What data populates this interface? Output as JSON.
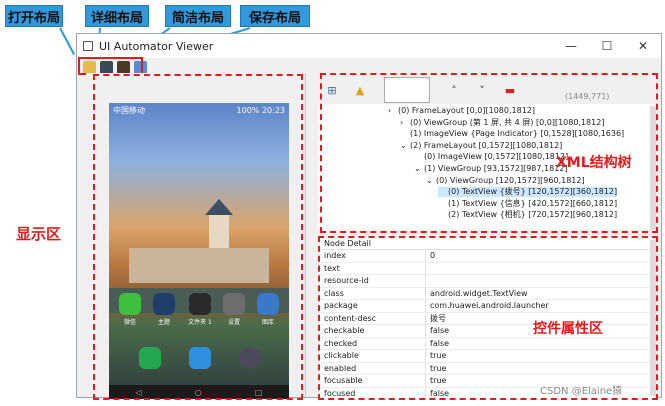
{
  "callouts": {
    "open": "打开布局",
    "detail": "详细布局",
    "compact": "简洁布局",
    "save": "保存布局"
  },
  "window": {
    "title": "UI Automator Viewer",
    "minimize": "—",
    "maximize": "☐",
    "close": "✕"
  },
  "phone": {
    "status_left": "中国移动",
    "status_right": "100%",
    "time": "20:23",
    "apps": [
      {
        "label": "微信",
        "color": "#3fbf3f"
      },
      {
        "label": "主题",
        "color": "#1f3f6a"
      },
      {
        "label": "文件夹 1",
        "color": "#2a2a2a"
      },
      {
        "label": "设置",
        "color": "#6e6e6e"
      },
      {
        "label": "图库",
        "color": "#3a78c8"
      }
    ],
    "dock": [
      {
        "name": "phone-app-icon",
        "color": "#23a84f"
      },
      {
        "name": "messages-app-icon",
        "color": "#2f8fe0"
      },
      {
        "name": "camera-app-icon",
        "color": "#4a4a5a"
      }
    ],
    "nav": {
      "back": "◁",
      "home": "○",
      "recent": "□"
    }
  },
  "tree_toolbar": {
    "expand": "⊞",
    "warn": "▲",
    "up": "˄",
    "down": "˅",
    "minus": "▬",
    "coord": "(1449,771)"
  },
  "tree": [
    {
      "text": "(0) FrameLayout [0,0][1080,1812]",
      "expander": "›",
      "sel": false
    },
    {
      "text": "(0) ViewGroup (第 1 屏, 共 4 屏) [0,0][1080,1812]",
      "expander": "›",
      "sel": false
    },
    {
      "text": "(1) ImageView {Page Indicator} [0,1528][1080,1636]",
      "expander": "",
      "sel": false
    },
    {
      "text": "(2) FrameLayout [0,1572][1080,1812]",
      "expander": "⌄",
      "sel": false
    },
    {
      "text": "(0) ImageView [0,1572][1080,1812]",
      "expander": "",
      "sel": false
    },
    {
      "text": "(1) ViewGroup [93,1572][987,1812]",
      "expander": "⌄",
      "sel": false
    },
    {
      "text": "(0) ViewGroup [120,1572][960,1812]",
      "expander": "⌄",
      "sel": false
    },
    {
      "text": "(0) TextView {拨号} [120,1572][360,1812]",
      "expander": "",
      "sel": true
    },
    {
      "text": "(1) TextView {信息} [420,1572][660,1812]",
      "expander": "",
      "sel": false
    },
    {
      "text": "(2) TextView {相机} [720,1572][960,1812]",
      "expander": "",
      "sel": false
    }
  ],
  "props": {
    "header": "Node Detail",
    "rows": [
      {
        "k": "index",
        "v": "0"
      },
      {
        "k": "text",
        "v": ""
      },
      {
        "k": "resource-id",
        "v": ""
      },
      {
        "k": "class",
        "v": "android.widget.TextView"
      },
      {
        "k": "package",
        "v": "com.huawei.android.launcher"
      },
      {
        "k": "content-desc",
        "v": "拨号"
      },
      {
        "k": "checkable",
        "v": "false"
      },
      {
        "k": "checked",
        "v": "false"
      },
      {
        "k": "clickable",
        "v": "true"
      },
      {
        "k": "enabled",
        "v": "true"
      },
      {
        "k": "focusable",
        "v": "true"
      },
      {
        "k": "focused",
        "v": "false"
      }
    ]
  },
  "labels": {
    "display": "显示区",
    "xml": "XML结构树",
    "props": "控件属性区"
  },
  "watermark": "CSDN @Elaine猿"
}
